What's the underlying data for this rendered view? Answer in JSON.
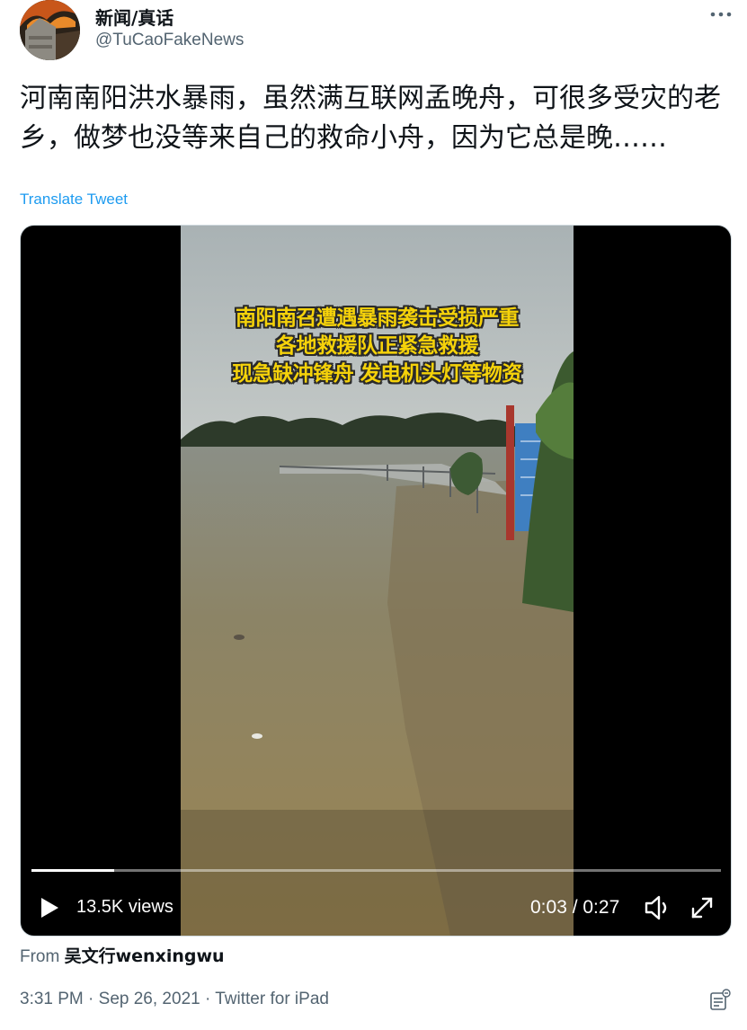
{
  "author": {
    "display_name": "新闻/真话",
    "handle": "@TuCaoFakeNews",
    "avatar_icon": "avatar-image"
  },
  "more_icon": "more-horizontal-icon",
  "tweet": {
    "text": "河南南阳洪水暴雨，虽然满互联网孟晚舟，可很多受灾的老乡，做梦也没等来自己的救命小舟，因为它总是晚……",
    "translate_label": "Translate Tweet"
  },
  "video": {
    "caption_lines": [
      "南阳南召遭遇暴雨袭击受损严重",
      "各地救援队正紧急救援",
      "现急缺冲锋舟 发电机头灯等物资"
    ],
    "views": "13.5K views",
    "time": "0:03 / 0:27",
    "progress": 0.12
  },
  "source": {
    "from_label": "From",
    "user": "吴文行wenxingwu"
  },
  "meta": {
    "time": "3:31 PM",
    "sep1": " · ",
    "date": "Sep 26, 2021",
    "sep2": " · ",
    "client": "Twitter for iPad"
  },
  "colors": {
    "link": "#1d9bf0",
    "secondary_text": "#536471",
    "primary_text": "#0f1419",
    "caption_yellow": "#f5d20a"
  }
}
